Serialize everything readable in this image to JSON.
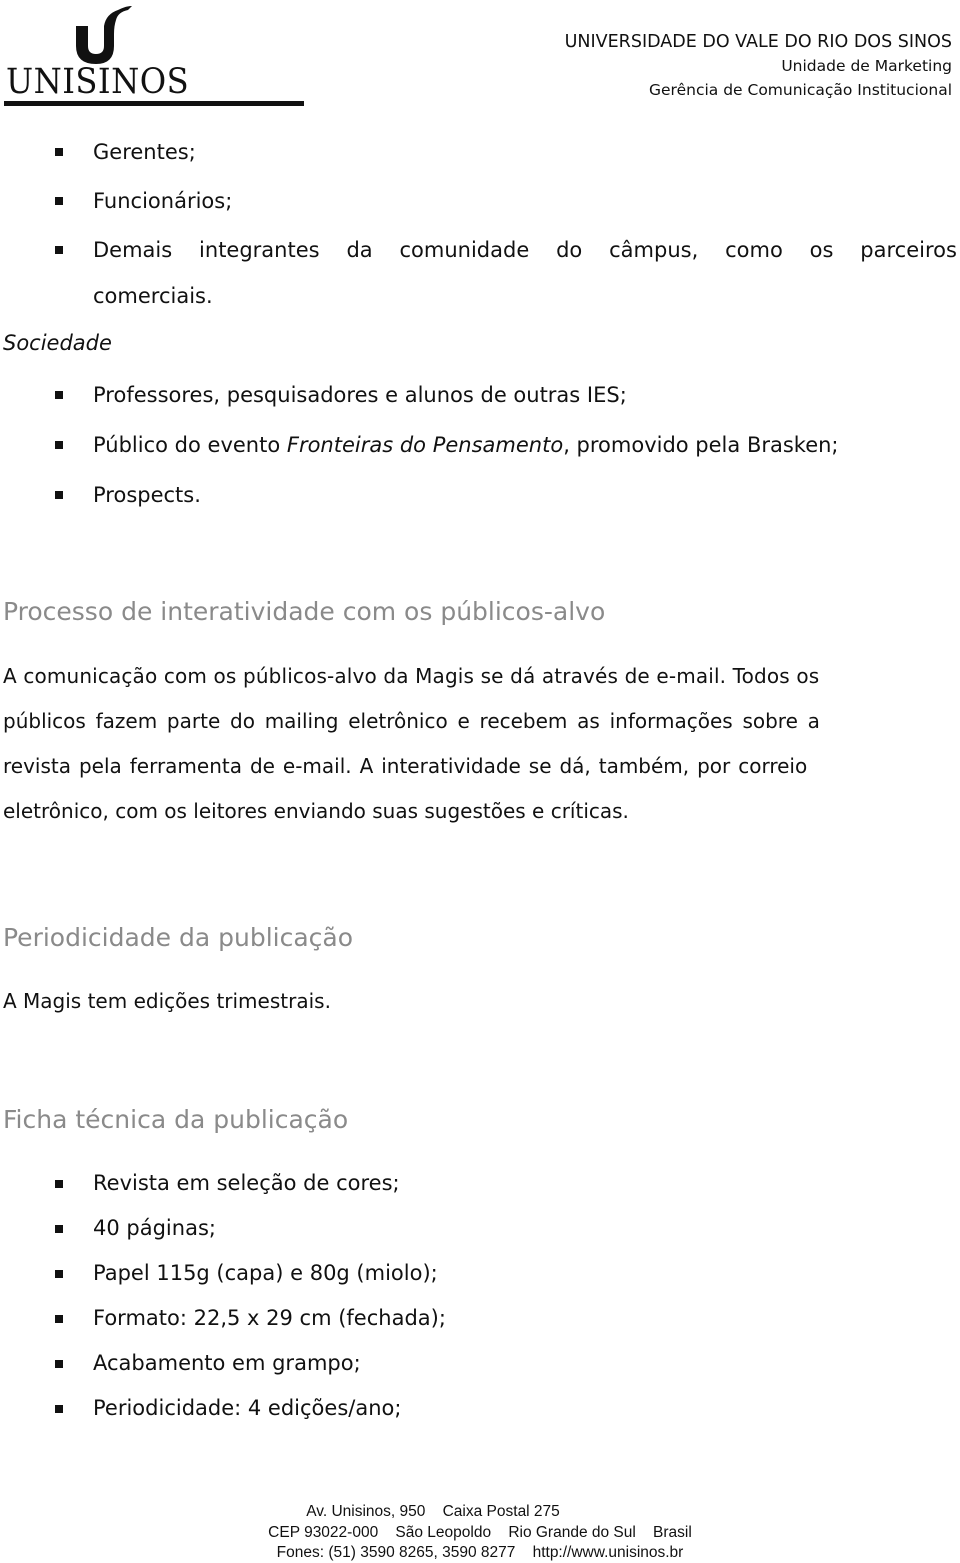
{
  "header": {
    "logo_text": "UNISINOS",
    "institution": "UNIVERSIDADE DO VALE DO RIO DOS SINOS",
    "unit": "Unidade de Marketing",
    "department": "Gerência de Comunicação Institucional"
  },
  "internal_list": {
    "items": [
      "Gerentes;",
      "Funcionários;"
    ],
    "long_item_line1_words": [
      "Demais",
      "integrantes",
      "da",
      "comunidade",
      "do",
      "câmpus,",
      "como",
      "os",
      "parceiros"
    ],
    "long_item_line2": "comerciais."
  },
  "sociedade": {
    "label": "Sociedade",
    "items": [
      {
        "text": "Professores, pesquisadores e alunos de outras IES;"
      },
      {
        "before": "Público do evento ",
        "italic": "Fronteiras do Pensamento",
        "after": ", promovido pela Brasken;"
      },
      {
        "text": "Prospects."
      }
    ]
  },
  "interatividade": {
    "heading": "Processo de interatividade com os públicos-alvo",
    "lines": [
      "A comunicação com os públicos-alvo da Magis se dá através de e-mail. Todos os",
      "públicos fazem parte do mailing eletrônico e recebem as informações sobre a",
      "revista pela ferramenta de e-mail. A interatividade se dá, também, por correio"
    ],
    "last_line": "eletrônico, com os leitores enviando suas sugestões e críticas."
  },
  "periodicidade": {
    "heading": "Periodicidade da publicação",
    "text": "A Magis tem edições trimestrais."
  },
  "ficha": {
    "heading": "Ficha técnica da publicação",
    "items": [
      "Revista em seleção de cores;",
      "40 páginas;",
      "Papel 115g (capa) e 80g (miolo);",
      "Formato: 22,5 x 29 cm (fechada);",
      "Acabamento em grampo;",
      "Periodicidade: 4 edições/ano;"
    ]
  },
  "footer": {
    "line1": "Av. Unisinos, 950    Caixa Postal 275",
    "line2": "CEP 93022-000    São Leopoldo    Rio Grande do Sul    Brasil",
    "line3": "Fones: (51) 3590 8265, 3590 8277    http://www.unisinos.br"
  }
}
